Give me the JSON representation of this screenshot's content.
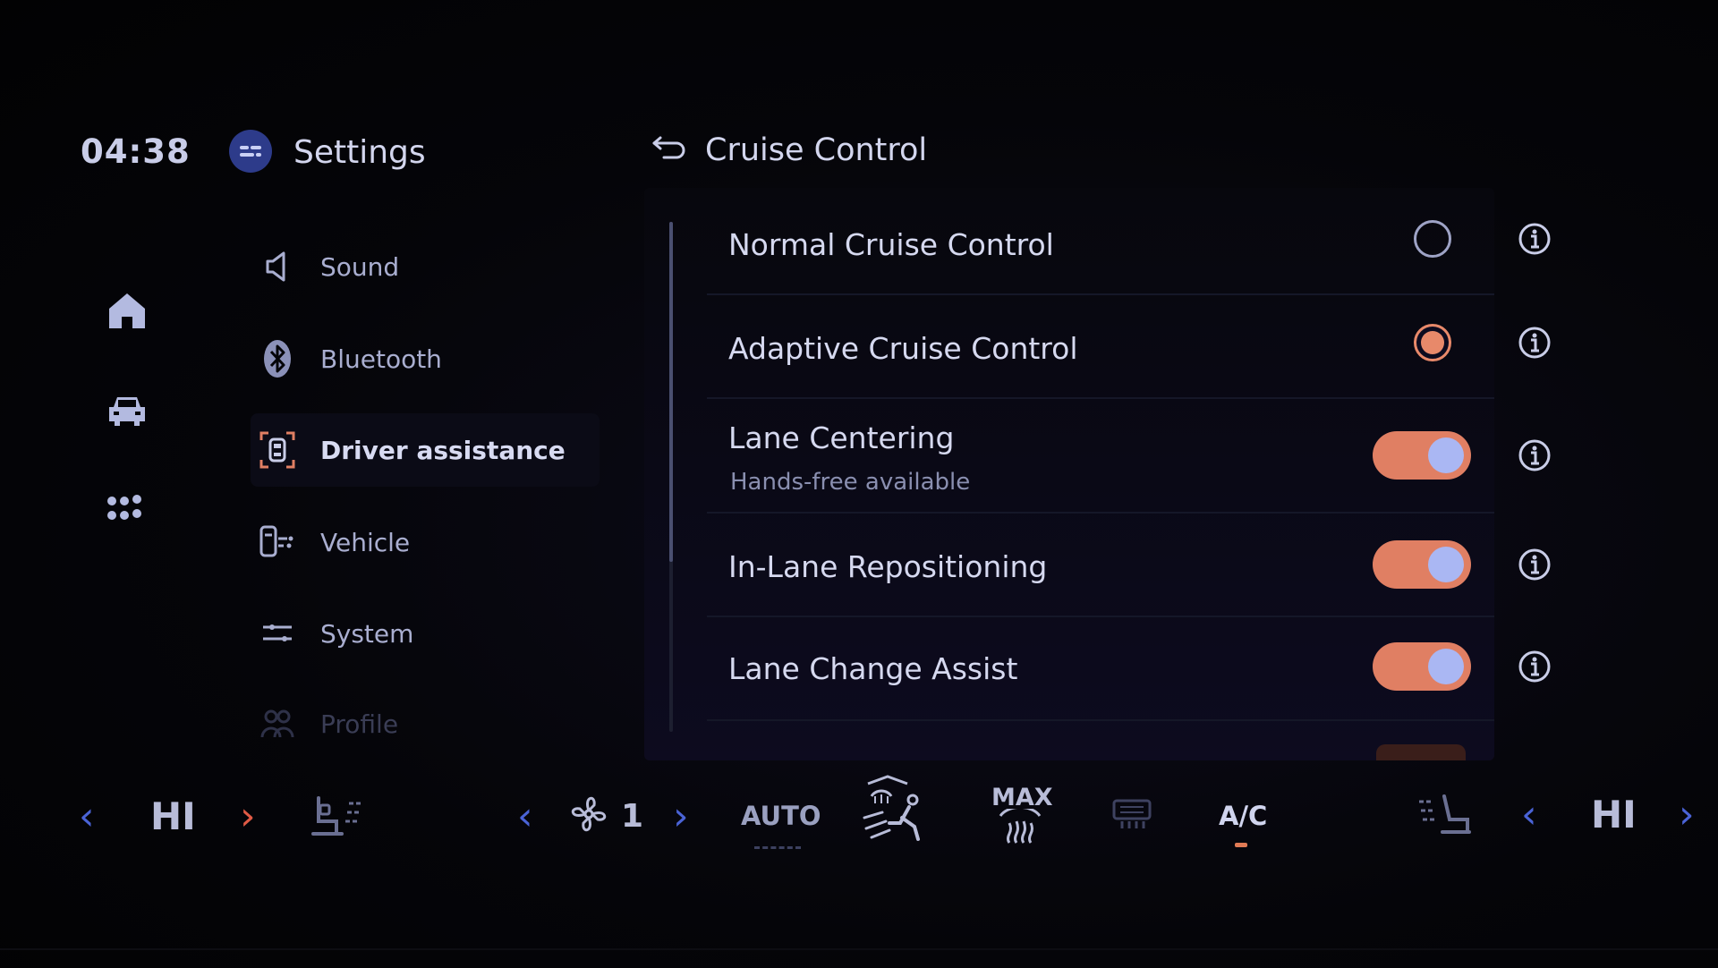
{
  "header": {
    "clock": "04:38",
    "app_title": "Settings",
    "page_title": "Cruise Control"
  },
  "sidebar": {
    "items": [
      {
        "label": "Sound",
        "icon": "speaker-icon"
      },
      {
        "label": "Bluetooth",
        "icon": "bluetooth-icon"
      },
      {
        "label": "Driver assistance",
        "icon": "driver-assist-icon",
        "active": true
      },
      {
        "label": "Vehicle",
        "icon": "vehicle-settings-icon"
      },
      {
        "label": "System",
        "icon": "sliders-icon"
      },
      {
        "label": "Profile",
        "icon": "profile-icon"
      }
    ]
  },
  "rail": {
    "icons": [
      "home-icon",
      "car-icon",
      "apps-grid-icon"
    ]
  },
  "options": [
    {
      "title": "Normal Cruise Control",
      "control": "radio",
      "selected": false
    },
    {
      "title": "Adaptive Cruise Control",
      "control": "radio",
      "selected": true
    },
    {
      "title": "Lane Centering",
      "subtitle": "Hands-free available",
      "control": "toggle",
      "on": true
    },
    {
      "title": "In-Lane Repositioning",
      "control": "toggle",
      "on": true
    },
    {
      "title": "Lane Change Assist",
      "control": "toggle",
      "on": true
    }
  ],
  "climate": {
    "left_temp": "HI",
    "fan_speed": "1",
    "auto_label": "AUTO",
    "max_label": "MAX",
    "ac_label": "A/C",
    "right_temp": "HI"
  },
  "colors": {
    "accent": "#e07f63",
    "knob": "#aab7f3",
    "chevron_blue": "#4a63d6",
    "chevron_red": "#e05a45"
  }
}
